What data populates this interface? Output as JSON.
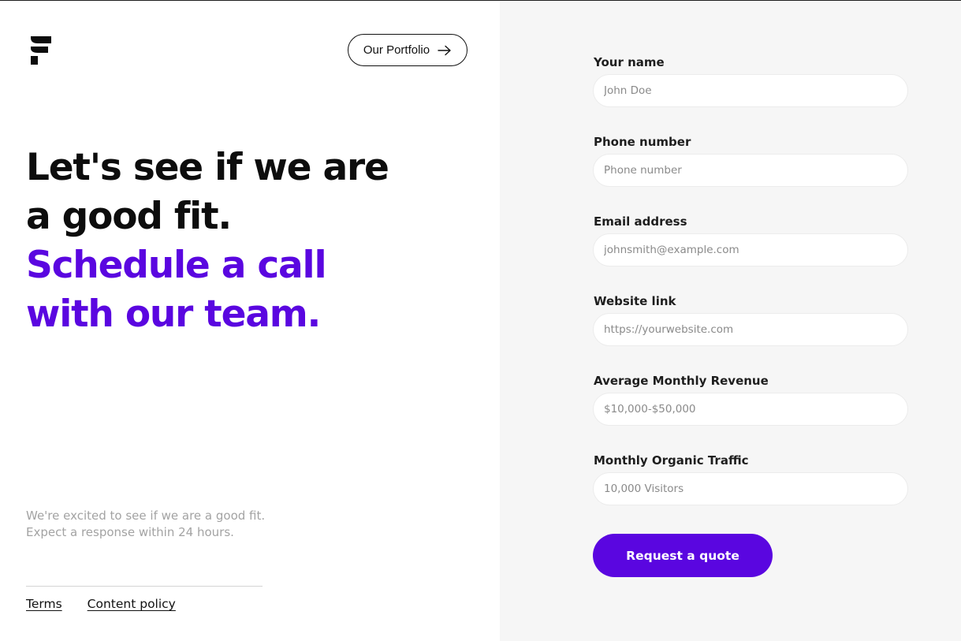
{
  "brand": {
    "logo_icon": "brand-f-logo-icon",
    "accent_color": "#5a06e0",
    "right_panel_bg": "#f6f6f6"
  },
  "header": {
    "portfolio_label": "Our Portfolio",
    "portfolio_icon": "arrow-right-icon"
  },
  "hero": {
    "line1": "Let's see if we are",
    "line2": "a good fit.",
    "line3": "Schedule a call",
    "line4": "with our team."
  },
  "intro": {
    "line1": "We're excited to see if we are a good fit.",
    "line2": "Expect a response within 24 hours."
  },
  "footer": {
    "terms": "Terms",
    "content_policy": "Content policy"
  },
  "form": {
    "fields": [
      {
        "label": "Your name",
        "placeholder": "John Doe"
      },
      {
        "label": "Phone number",
        "placeholder": "Phone number"
      },
      {
        "label": "Email address",
        "placeholder": "johnsmith@example.com"
      },
      {
        "label": "Website link",
        "placeholder": "https://yourwebsite.com"
      },
      {
        "label": "Average Monthly Revenue",
        "placeholder": "$10,000-$50,000"
      },
      {
        "label": "Monthly Organic Traffic",
        "placeholder": "10,000 Visitors"
      }
    ],
    "submit_label": "Request a quote"
  }
}
